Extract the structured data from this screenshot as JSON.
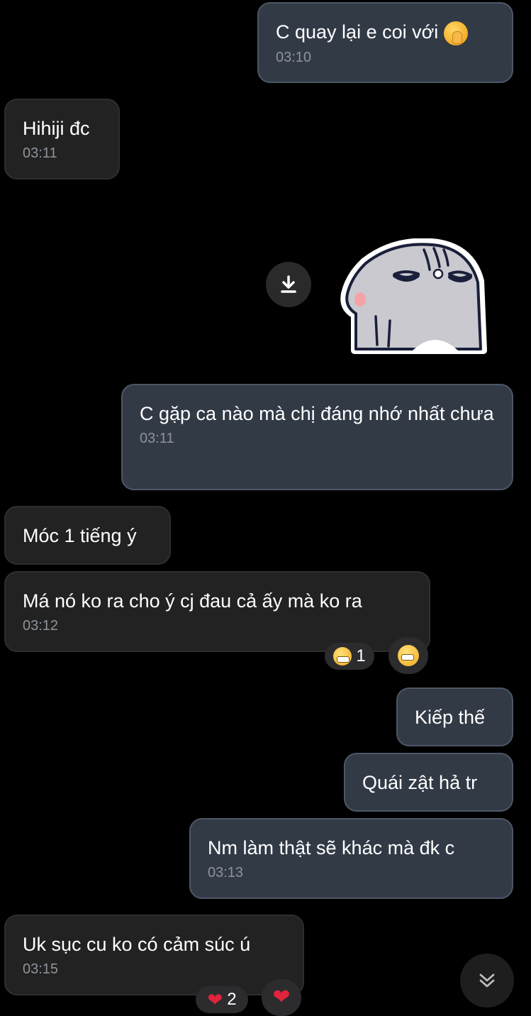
{
  "messages": [
    {
      "text": "C quay lại e coi với",
      "time": "03:10",
      "direction": "outgoing"
    },
    {
      "text": "Hihiji đc",
      "time": "03:11",
      "direction": "incoming"
    },
    {
      "text": "C gặp ca nào mà chị đáng nhớ nhất chưa",
      "time": "03:11",
      "direction": "outgoing"
    },
    {
      "text": "Móc 1 tiếng ý",
      "direction": "incoming"
    },
    {
      "text": "Má nó ko ra cho ý cj đau cả ấy mà ko ra",
      "time": "03:12",
      "direction": "incoming"
    },
    {
      "text": "Kiếp thế",
      "direction": "outgoing"
    },
    {
      "text": "Quái zật hả tr",
      "direction": "outgoing"
    },
    {
      "text": "Nm làm thật sẽ khác mà đk c",
      "time": "03:13",
      "direction": "outgoing"
    },
    {
      "text": "Uk sục cu ko có cảm súc ú",
      "time": "03:15",
      "direction": "incoming"
    }
  ],
  "reactions": {
    "m5_count": "1",
    "m9_count": "2"
  },
  "icons": {
    "download": "download-icon",
    "scroll_down": "chevron-double-down-icon",
    "sticker": "gray-seal-sticker"
  },
  "colors": {
    "background": "#000000",
    "outgoing_bubble": "#323a46",
    "incoming_bubble": "#222222",
    "timestamp": "#8e949c"
  }
}
